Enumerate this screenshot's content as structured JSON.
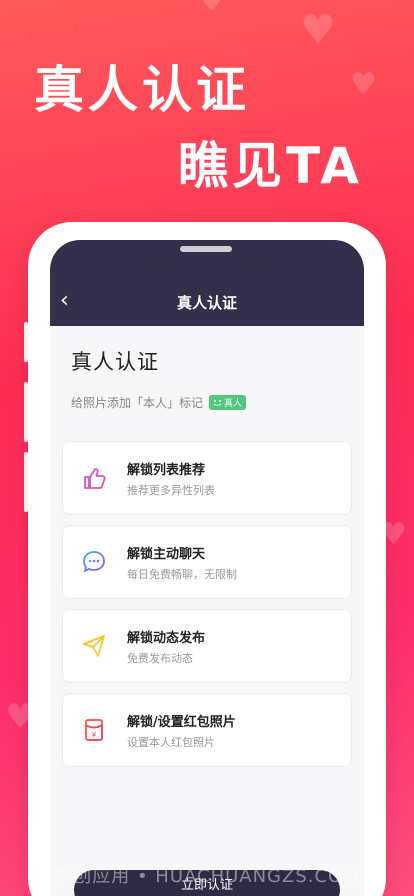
{
  "hero": {
    "line1": "真人认证",
    "line2": "瞧见TA"
  },
  "nav": {
    "back_icon": "‹",
    "title": "真人认证"
  },
  "page": {
    "title": "真人认证",
    "subtitle": "给照片添加「本人」标记",
    "tag": "真人"
  },
  "features": [
    {
      "title": "解锁列表推荐",
      "desc": "推荐更多异性列表",
      "icon": "thumbs-up-icon"
    },
    {
      "title": "解锁主动聊天",
      "desc": "每日免费畅聊，无限制",
      "icon": "chat-bubble-icon"
    },
    {
      "title": "解锁动态发布",
      "desc": "免费发布动态",
      "icon": "paper-plane-icon"
    },
    {
      "title": "解锁/设置红包照片",
      "desc": "设置本人红包照片",
      "icon": "red-envelope-icon"
    }
  ],
  "cta": {
    "label": "立即认证"
  },
  "watermark": "华创应用 • HUACHUANGZS.COM"
}
